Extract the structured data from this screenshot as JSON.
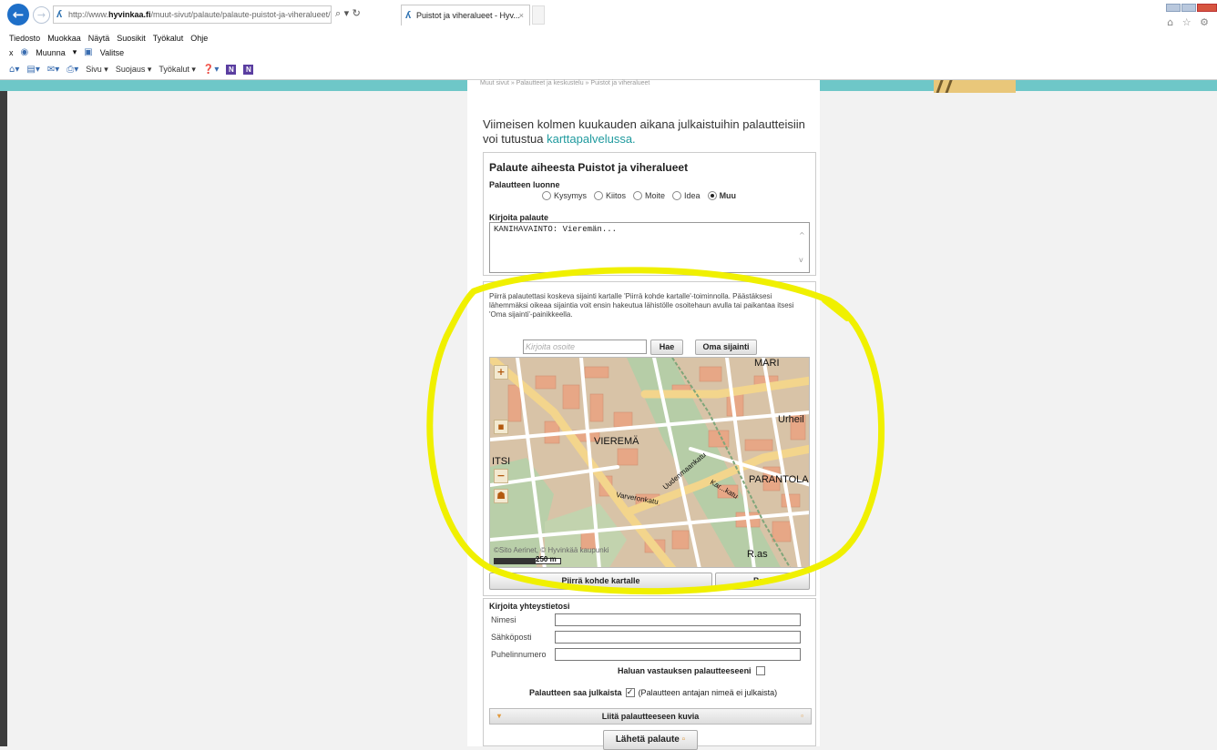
{
  "browser": {
    "url_prefix": "http://www.",
    "url_domain": "hyvinkaa.fi",
    "url_path": "/muut-sivut/palaute/palaute-puistot-ja-viheralueet/",
    "addr_tools": "⌕ ▾ ↻",
    "tab_title": "Puistot ja viheralueet - Hyv...",
    "tab_close": "×",
    "back_icon": "←",
    "fwd_icon": "→",
    "right_icons": "⌂ ☆ ⚙"
  },
  "menubar": [
    "Tiedosto",
    "Muokkaa",
    "Näytä",
    "Suosikit",
    "Työkalut",
    "Ohje"
  ],
  "favbar": {
    "close": "x",
    "item1": "Muunna",
    "item1_arrow": "▾",
    "item2": "Valitse"
  },
  "cmdbar": {
    "sivu": "Sivu ▾",
    "suojaus": "Suojaus ▾",
    "tyokalut": "Työkalut ▾"
  },
  "breadcrumb": "Muut sivut » Palautteet ja keskustelu » Puistot ja viheralueet",
  "intro": {
    "text": "Viimeisen kolmen kuukauden aikana julkaistuihin palautteisiin voi tutustua ",
    "link": "karttapalvelussa."
  },
  "feedback": {
    "title": "Palaute aiheesta Puistot ja viheralueet",
    "nature_label": "Palautteen luonne",
    "options": [
      "Kysymys",
      "Kiitos",
      "Moite",
      "Idea",
      "Muu"
    ],
    "selected_option": "Muu",
    "message_label": "Kirjoita palaute",
    "message_value": "KANIHAVAINTO: Vieremän...",
    "scroll_up": "^",
    "scroll_down": "v"
  },
  "map": {
    "instructions": "Piirrä palautettasi koskeva sijainti kartalle 'Piirrä kohde kartalle'-toiminnolla. Päästäksesi lähemmäksi oikeaa sijaintia voit ensin hakeutua lähistölle osoitehaun avulla tai paikantaa itsesi 'Oma sijainti'-painikkeella.",
    "address_placeholder": "Kirjoita osoite",
    "search_button": "Hae",
    "location_button": "Oma sijainti",
    "zoom_in": "+",
    "zoom_mid": "▪",
    "zoom_out": "−",
    "person": "☗",
    "labels": {
      "vierema": "VIEREMÄ",
      "parantola": "PARANTOLA",
      "urheil": "Urheil",
      "itsi": "ITSI",
      "mari": "MARI",
      "ras": "R.as",
      "varveronkatu": "Varveronkatu",
      "uudenmaankatu": "Uudenmaankatu",
      "karankatu": "Kar...katu"
    },
    "copyright": "©Sito Aerinet, © Hyvinkää kaupunki",
    "scale": "250 m",
    "draw_button": "Piirrä kohde kartalle",
    "cancel_button": "Peru"
  },
  "contact": {
    "title": "Kirjoita yhteystietosi",
    "fields": [
      "Nimesi",
      "Sähköposti",
      "Puhelinnumero"
    ],
    "want_reply": "Haluan vastauksen palautteeseeni",
    "publish_label": "Palautteen saa julkaista",
    "publish_checked": "✓",
    "publish_note": "(Palautteen antajan nimeä ei julkaista)",
    "attach_images": "Liitä palautteeseen kuvia",
    "attach_left": "▾",
    "attach_right": "▫",
    "send_button": "Lähetä palaute",
    "send_icon": "▫"
  },
  "colors": {
    "teal_bar": "#6ec7c8",
    "link": "#1f9a9e",
    "annotation": "#f0f000",
    "browser_blue": "#1e6fc8"
  }
}
